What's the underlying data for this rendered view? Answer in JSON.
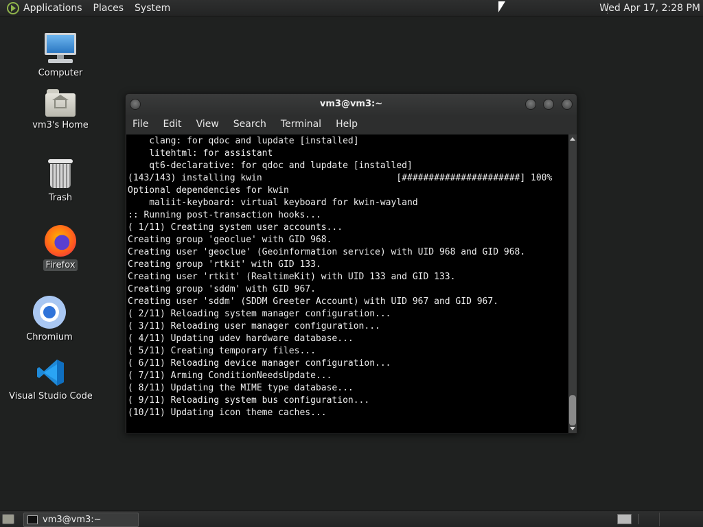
{
  "top_panel": {
    "menus": [
      "Applications",
      "Places",
      "System"
    ],
    "clock": "Wed Apr 17,  2:28 PM",
    "logo_icon": "mate-logo-icon"
  },
  "desktop_icons": [
    {
      "label": "Computer",
      "icon": "computer-icon"
    },
    {
      "label": "vm3's Home",
      "icon": "home-folder-icon"
    },
    {
      "label": "Trash",
      "icon": "trash-icon"
    },
    {
      "label": "Firefox",
      "icon": "firefox-icon",
      "selected": true
    },
    {
      "label": "Chromium",
      "icon": "chromium-icon"
    },
    {
      "label": "Visual Studio Code",
      "icon": "vscode-icon"
    }
  ],
  "terminal": {
    "title": "vm3@vm3:~",
    "menu": [
      "File",
      "Edit",
      "View",
      "Search",
      "Terminal",
      "Help"
    ],
    "lines": [
      "    clang: for qdoc and lupdate [installed]",
      "    litehtml: for assistant",
      "    qt6-declarative: for qdoc and lupdate [installed]",
      "(143/143) installing kwin                         [######################] 100%",
      "Optional dependencies for kwin",
      "    maliit-keyboard: virtual keyboard for kwin-wayland",
      ":: Running post-transaction hooks...",
      "( 1/11) Creating system user accounts...",
      "Creating group 'geoclue' with GID 968.",
      "Creating user 'geoclue' (Geoinformation service) with UID 968 and GID 968.",
      "Creating group 'rtkit' with GID 133.",
      "Creating user 'rtkit' (RealtimeKit) with UID 133 and GID 133.",
      "Creating group 'sddm' with GID 967.",
      "Creating user 'sddm' (SDDM Greeter Account) with UID 967 and GID 967.",
      "( 2/11) Reloading system manager configuration...",
      "( 3/11) Reloading user manager configuration...",
      "( 4/11) Updating udev hardware database...",
      "( 5/11) Creating temporary files...",
      "( 6/11) Reloading device manager configuration...",
      "( 7/11) Arming ConditionNeedsUpdate...",
      "( 8/11) Updating the MIME type database...",
      "( 9/11) Reloading system bus configuration...",
      "(10/11) Updating icon theme caches..."
    ]
  },
  "taskbar": {
    "task_label": "vm3@vm3:~"
  }
}
